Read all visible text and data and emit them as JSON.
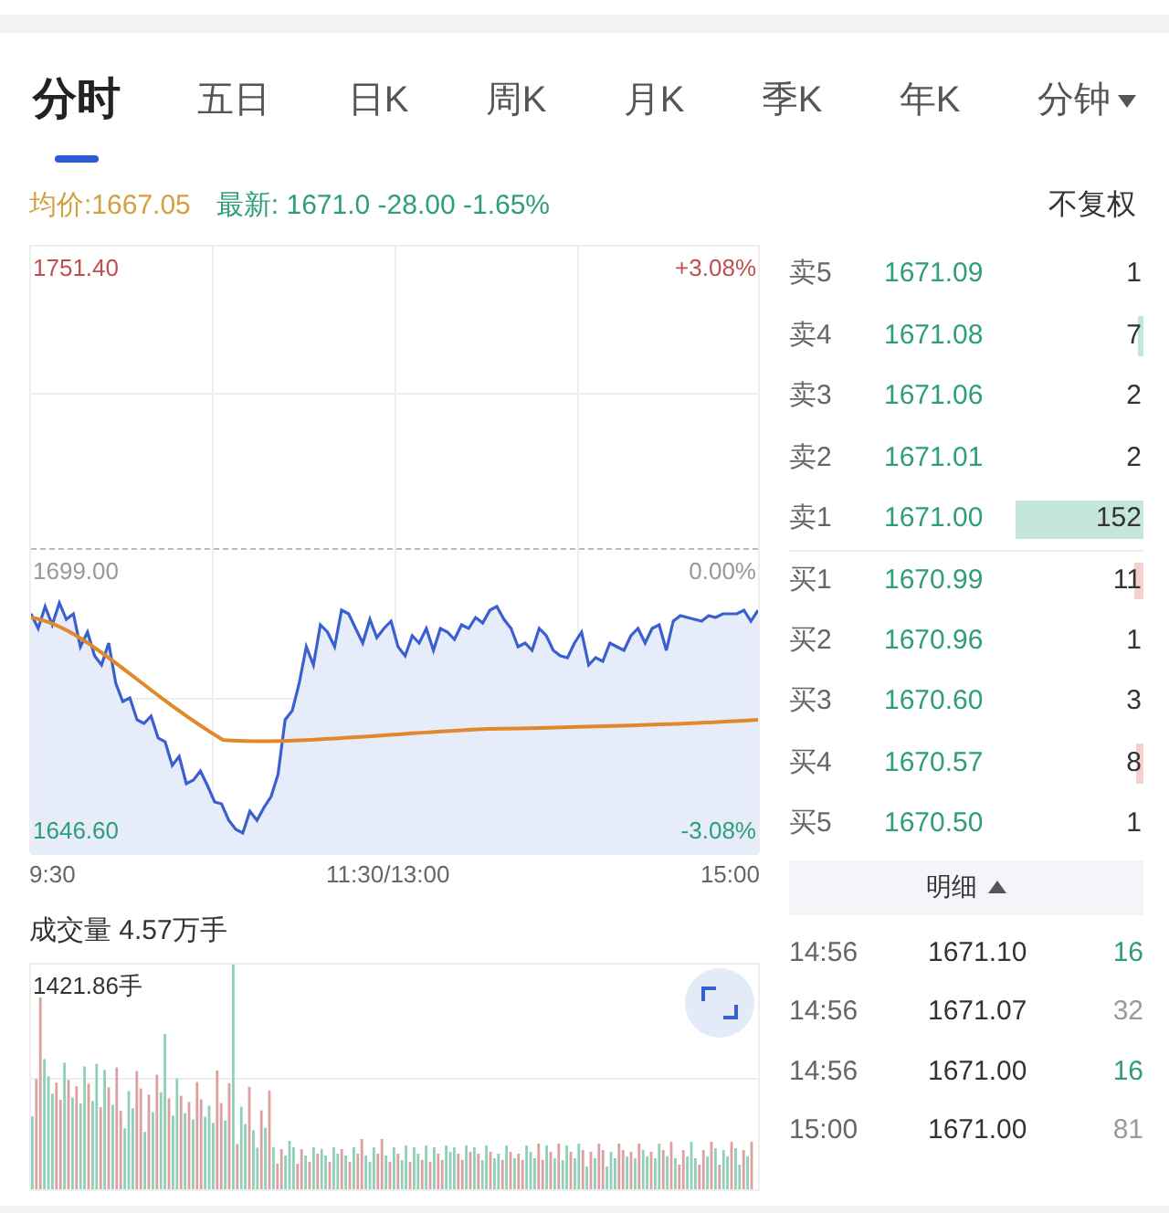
{
  "tabs": [
    {
      "label": "分时",
      "selected": true
    },
    {
      "label": "五日",
      "selected": false
    },
    {
      "label": "日K",
      "selected": false
    },
    {
      "label": "周K",
      "selected": false
    },
    {
      "label": "月K",
      "selected": false
    },
    {
      "label": "季K",
      "selected": false
    },
    {
      "label": "年K",
      "selected": false
    },
    {
      "label": "分钟",
      "selected": false,
      "dropdown": true
    }
  ],
  "info": {
    "avg_label": "均价:",
    "avg_value": "1667.05",
    "latest_label": "最新:",
    "latest_value": "1671.0 -28.00 -1.65%",
    "adjust": "不复权"
  },
  "chart": {
    "top_price": "1751.40",
    "top_pct": "+3.08%",
    "mid_price": "1699.00",
    "mid_pct": "0.00%",
    "low_price": "1646.60",
    "low_pct": "-3.08%",
    "times": [
      "9:30",
      "11:30/13:00",
      "15:00"
    ]
  },
  "volume": {
    "title": "成交量 4.57万手",
    "max_label": "1421.86手"
  },
  "order_book": [
    {
      "label": "卖5",
      "price": "1671.09",
      "qty": "1",
      "kind": "sell"
    },
    {
      "label": "卖4",
      "price": "1671.08",
      "qty": "7",
      "kind": "sell"
    },
    {
      "label": "卖3",
      "price": "1671.06",
      "qty": "2",
      "kind": "sell"
    },
    {
      "label": "卖2",
      "price": "1671.01",
      "qty": "2",
      "kind": "sell"
    },
    {
      "label": "卖1",
      "price": "1671.00",
      "qty": "152",
      "kind": "sell"
    },
    {
      "label": "买1",
      "price": "1670.99",
      "qty": "11",
      "kind": "buy"
    },
    {
      "label": "买2",
      "price": "1670.96",
      "qty": "1",
      "kind": "buy"
    },
    {
      "label": "买3",
      "price": "1670.60",
      "qty": "3",
      "kind": "buy"
    },
    {
      "label": "买4",
      "price": "1670.57",
      "qty": "8",
      "kind": "buy"
    },
    {
      "label": "买5",
      "price": "1670.50",
      "qty": "1",
      "kind": "buy"
    }
  ],
  "details": {
    "title": "明细",
    "expanded": true,
    "rows": [
      {
        "time": "14:56",
        "price": "1671.10",
        "qty": "16",
        "color": "#2e9e78"
      },
      {
        "time": "14:56",
        "price": "1671.07",
        "qty": "32",
        "color": "#9a9a9a"
      },
      {
        "time": "14:56",
        "price": "1671.00",
        "qty": "16",
        "color": "#2e9e78"
      },
      {
        "time": "15:00",
        "price": "1671.00",
        "qty": "81",
        "color": "#9a9a9a"
      }
    ]
  }
}
